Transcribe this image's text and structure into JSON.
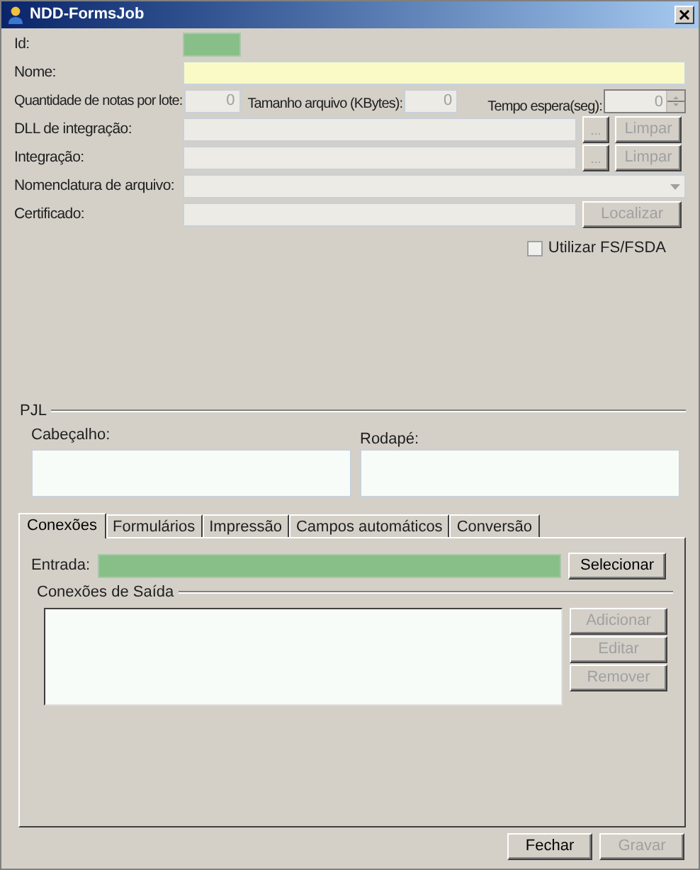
{
  "window": {
    "title": "NDD-FormsJob"
  },
  "rows": [
    {
      "kind": "short",
      "label": "Id:",
      "readonly": true
    },
    {
      "kind": "text",
      "label": "Nome:",
      "required": true
    },
    {
      "kind": "numbers",
      "items": [
        {
          "kind": "number",
          "label": "Quantidade de notas por lote:",
          "value": "0"
        },
        {
          "kind": "number",
          "label": "Tamanho arquivo (KBytes):",
          "value": "0"
        },
        {
          "kind": "spin",
          "label": "Tempo espera(seg):",
          "value": "0"
        }
      ]
    },
    {
      "kind": "browse",
      "label": "DLL de integração:",
      "disabled": true,
      "browse": "...",
      "clear": "Limpar"
    },
    {
      "kind": "browse",
      "label": "Integração:",
      "disabled": true,
      "browse": "...",
      "clear": "Limpar"
    },
    {
      "kind": "combo",
      "label": "Nomenclatura de arquivo:",
      "disabled": true
    },
    {
      "kind": "locate",
      "label": "Certificado:",
      "disabled": true,
      "button": "Localizar"
    }
  ],
  "checkbox": {
    "label": "Utilizar FS/FSDA",
    "checked": false
  },
  "pjl": {
    "title": "PJL",
    "header_label": "Cabeçalho:",
    "footer_label": "Rodapé:"
  },
  "tabs": [
    {
      "label": "Conexões",
      "selected": true
    },
    {
      "label": "Formulários",
      "selected": false
    },
    {
      "label": "Impressão",
      "selected": false
    },
    {
      "label": "Campos automáticos",
      "selected": false
    },
    {
      "label": "Conversão",
      "selected": false
    }
  ],
  "entrada": {
    "label": "Entrada:",
    "readonly": true,
    "button": "Selecionar"
  },
  "saida": {
    "title": "Conexões de Saída",
    "buttons": [
      {
        "label": "Adicionar",
        "disabled": true
      },
      {
        "label": "Editar",
        "disabled": true
      },
      {
        "label": "Remover",
        "disabled": true
      }
    ]
  },
  "footer": [
    {
      "label": "Fechar",
      "disabled": false
    },
    {
      "label": "Gravar",
      "disabled": true
    }
  ]
}
